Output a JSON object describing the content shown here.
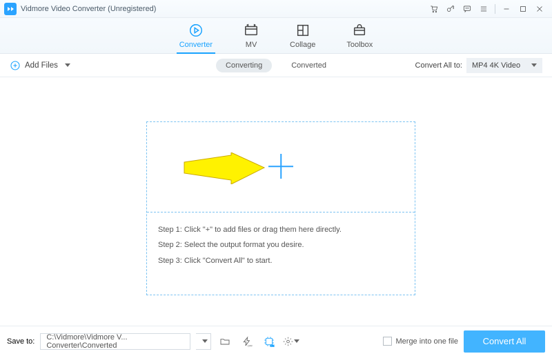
{
  "title": "Vidmore Video Converter (Unregistered)",
  "tabs": [
    {
      "label": "Converter"
    },
    {
      "label": "MV"
    },
    {
      "label": "Collage"
    },
    {
      "label": "Toolbox"
    }
  ],
  "toolbar": {
    "add_files": "Add Files",
    "converting": "Converting",
    "converted": "Converted",
    "convert_all_to": "Convert All to:",
    "format": "MP4 4K Video"
  },
  "steps": {
    "s1": "Step 1: Click \"+\" to add files or drag them here directly.",
    "s2": "Step 2: Select the output format you desire.",
    "s3": "Step 3: Click \"Convert All\" to start."
  },
  "footer": {
    "save_to": "Save to:",
    "path": "C:\\Vidmore\\Vidmore V... Converter\\Converted",
    "merge": "Merge into one file",
    "convert_all": "Convert All"
  }
}
